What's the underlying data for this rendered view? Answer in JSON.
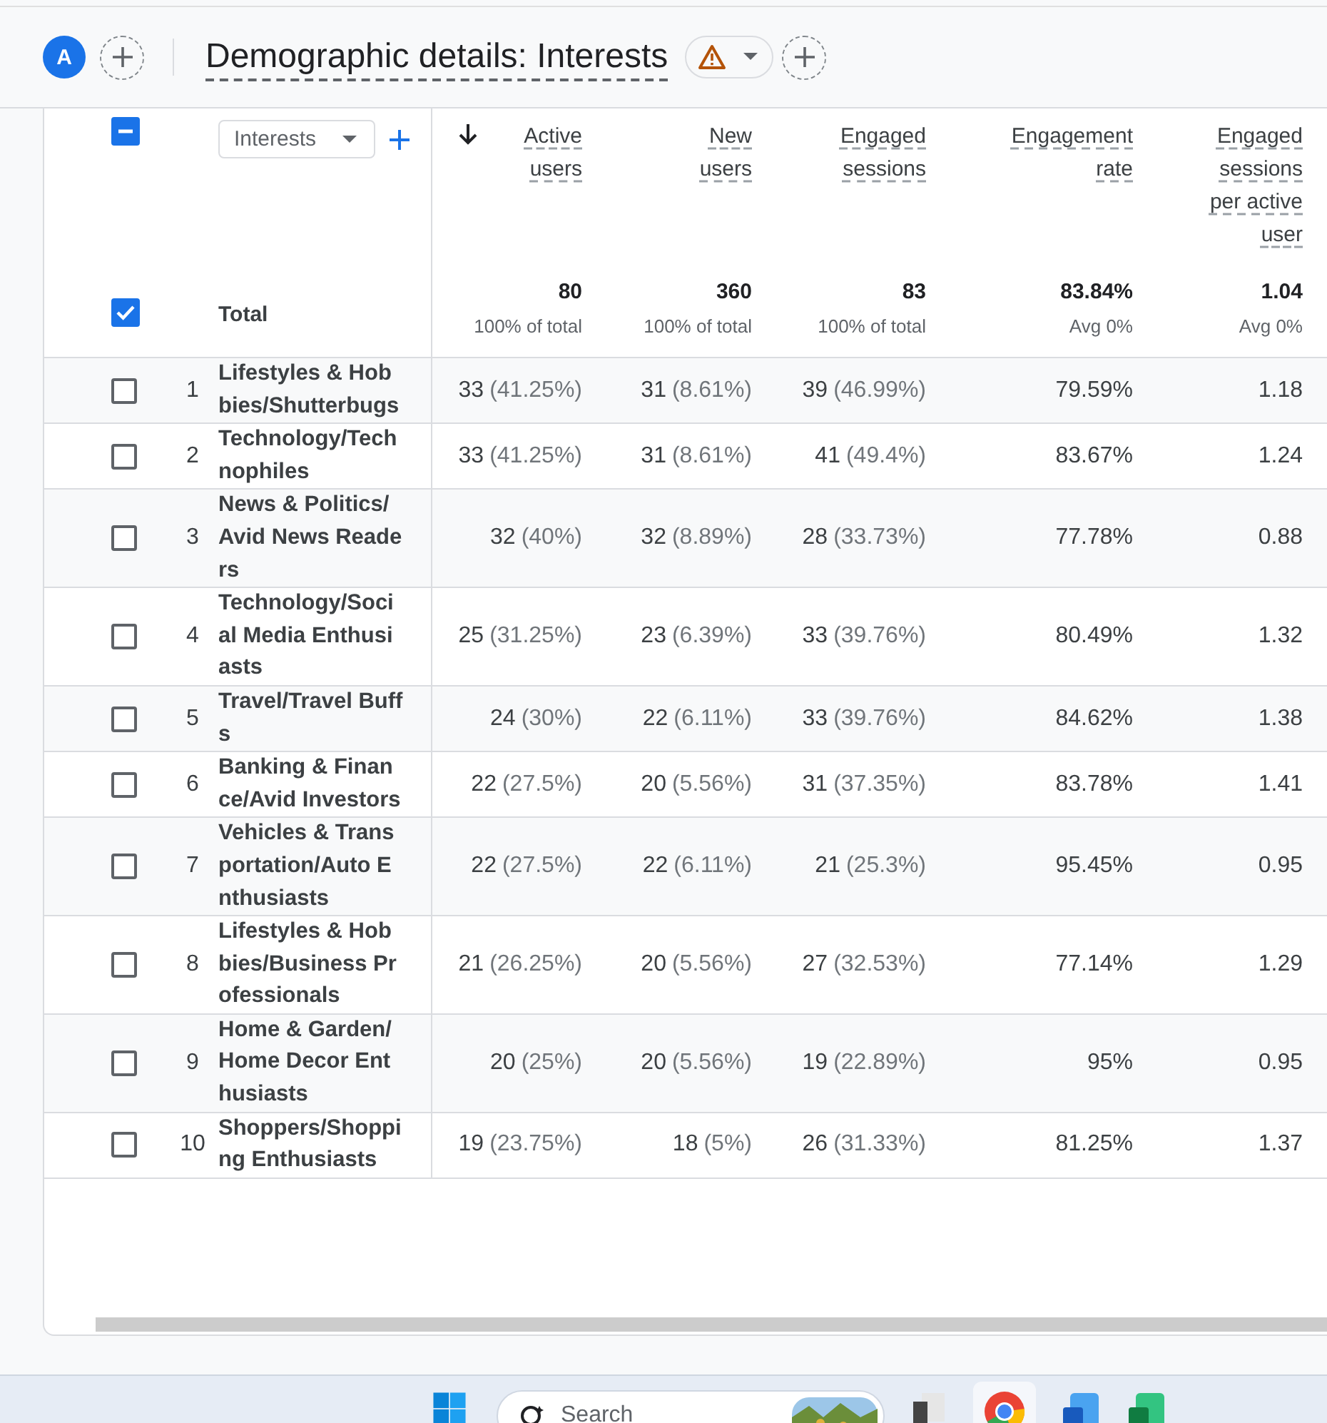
{
  "header": {
    "avatar": "A",
    "title": "Demographic details: Interests"
  },
  "table": {
    "select_all": {
      "indeterminate": true
    },
    "dimension": {
      "label": "Interests"
    },
    "columns": [
      {
        "label": "Active users",
        "sorted": true
      },
      {
        "label": "New users",
        "sorted": false
      },
      {
        "label": "Engaged sessions",
        "sorted": false
      },
      {
        "label": "Engagement rate",
        "sorted": false
      },
      {
        "label": "Engaged sessions per active user",
        "sorted": false
      }
    ],
    "total": {
      "label": "Total",
      "checked": true,
      "cells": [
        {
          "value": "80",
          "note": "100% of total"
        },
        {
          "value": "360",
          "note": "100% of total"
        },
        {
          "value": "83",
          "note": "100% of total"
        },
        {
          "value": "83.84%",
          "note": "Avg 0%"
        },
        {
          "value": "1.04",
          "note": "Avg 0%"
        }
      ]
    },
    "rows": [
      {
        "index": "1",
        "name": "Lifestyles & Hobbies/Shutterbugs",
        "checked": false,
        "cells": [
          {
            "value": "33",
            "share": "(41.25%)"
          },
          {
            "value": "31",
            "share": "(8.61%)"
          },
          {
            "value": "39",
            "share": "(46.99%)"
          },
          {
            "value": "79.59%"
          },
          {
            "value": "1.18"
          }
        ]
      },
      {
        "index": "2",
        "name": "Technology/Technophiles",
        "checked": false,
        "cells": [
          {
            "value": "33",
            "share": "(41.25%)"
          },
          {
            "value": "31",
            "share": "(8.61%)"
          },
          {
            "value": "41",
            "share": "(49.4%)"
          },
          {
            "value": "83.67%"
          },
          {
            "value": "1.24"
          }
        ]
      },
      {
        "index": "3",
        "name": "News & Politics/Avid News Readers",
        "checked": false,
        "cells": [
          {
            "value": "32",
            "share": "(40%)"
          },
          {
            "value": "32",
            "share": "(8.89%)"
          },
          {
            "value": "28",
            "share": "(33.73%)"
          },
          {
            "value": "77.78%"
          },
          {
            "value": "0.88"
          }
        ]
      },
      {
        "index": "4",
        "name": "Technology/Social Media Enthusiasts",
        "checked": false,
        "cells": [
          {
            "value": "25",
            "share": "(31.25%)"
          },
          {
            "value": "23",
            "share": "(6.39%)"
          },
          {
            "value": "33",
            "share": "(39.76%)"
          },
          {
            "value": "80.49%"
          },
          {
            "value": "1.32"
          }
        ]
      },
      {
        "index": "5",
        "name": "Travel/Travel Buffs",
        "checked": false,
        "cells": [
          {
            "value": "24",
            "share": "(30%)"
          },
          {
            "value": "22",
            "share": "(6.11%)"
          },
          {
            "value": "33",
            "share": "(39.76%)"
          },
          {
            "value": "84.62%"
          },
          {
            "value": "1.38"
          }
        ]
      },
      {
        "index": "6",
        "name": "Banking & Finance/Avid Investors",
        "checked": false,
        "cells": [
          {
            "value": "22",
            "share": "(27.5%)"
          },
          {
            "value": "20",
            "share": "(5.56%)"
          },
          {
            "value": "31",
            "share": "(37.35%)"
          },
          {
            "value": "83.78%"
          },
          {
            "value": "1.41"
          }
        ]
      },
      {
        "index": "7",
        "name": "Vehicles & Transportation/Auto Enthusiasts",
        "checked": false,
        "cells": [
          {
            "value": "22",
            "share": "(27.5%)"
          },
          {
            "value": "22",
            "share": "(6.11%)"
          },
          {
            "value": "21",
            "share": "(25.3%)"
          },
          {
            "value": "95.45%"
          },
          {
            "value": "0.95"
          }
        ]
      },
      {
        "index": "8",
        "name": "Lifestyles & Hobbies/Business Professionals",
        "checked": false,
        "cells": [
          {
            "value": "21",
            "share": "(26.25%)"
          },
          {
            "value": "20",
            "share": "(5.56%)"
          },
          {
            "value": "27",
            "share": "(32.53%)"
          },
          {
            "value": "77.14%"
          },
          {
            "value": "1.29"
          }
        ]
      },
      {
        "index": "9",
        "name": "Home & Garden/Home Decor Enthusiasts",
        "checked": false,
        "cells": [
          {
            "value": "20",
            "share": "(25%)"
          },
          {
            "value": "20",
            "share": "(5.56%)"
          },
          {
            "value": "19",
            "share": "(22.89%)"
          },
          {
            "value": "95%"
          },
          {
            "value": "0.95"
          }
        ]
      },
      {
        "index": "10",
        "name": "Shoppers/Shopping Enthusiasts",
        "checked": false,
        "cells": [
          {
            "value": "19",
            "share": "(23.75%)"
          },
          {
            "value": "18",
            "share": "(5%)"
          },
          {
            "value": "26",
            "share": "(31.33%)"
          },
          {
            "value": "81.25%"
          },
          {
            "value": "1.37"
          }
        ]
      }
    ]
  },
  "taskbar": {
    "search_placeholder": "Search"
  }
}
